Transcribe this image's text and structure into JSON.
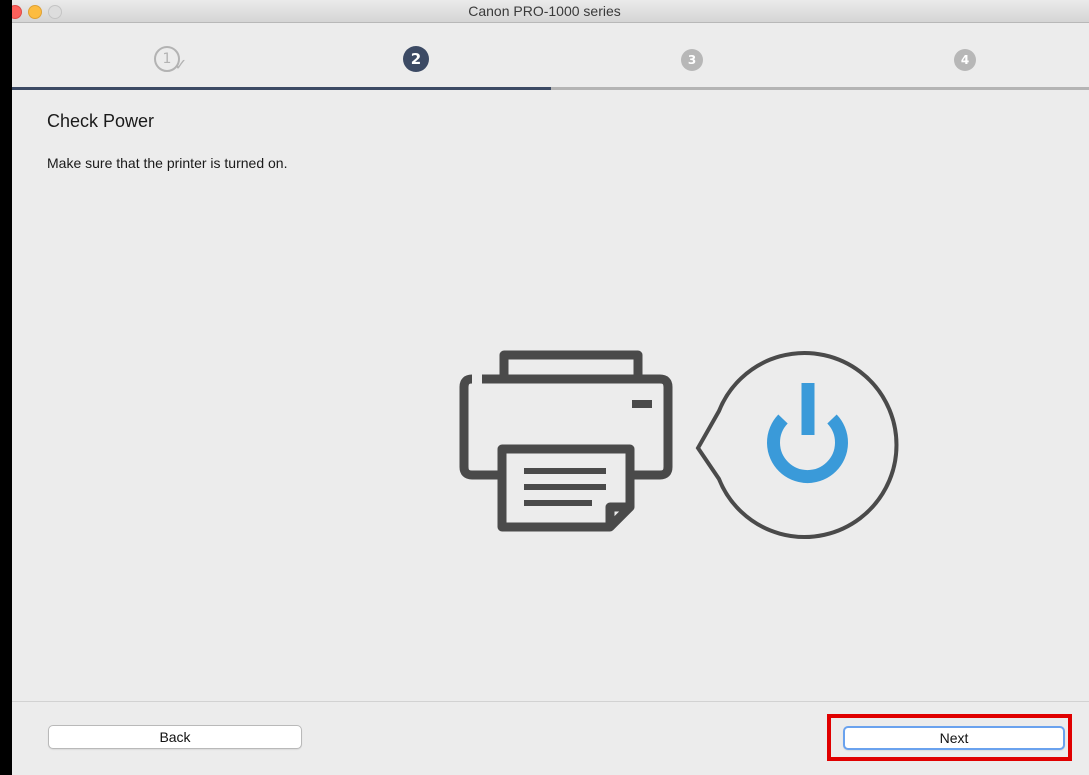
{
  "window": {
    "title": "Canon PRO-1000 series"
  },
  "steps": [
    {
      "label": "1",
      "state": "done"
    },
    {
      "label": "2",
      "state": "active"
    },
    {
      "label": "3",
      "state": "pending"
    },
    {
      "label": "4",
      "state": "pending"
    }
  ],
  "page": {
    "heading": "Check Power",
    "description": "Make sure that the printer is turned on."
  },
  "buttons": {
    "back": "Back",
    "next": "Next"
  },
  "colors": {
    "accent": "#3c4a64",
    "power_icon": "#3a9ad9",
    "printer_outline": "#4a4a4a",
    "highlight": "#e00000"
  },
  "icons": [
    "printer-icon",
    "power-icon",
    "speech-bubble-icon"
  ]
}
